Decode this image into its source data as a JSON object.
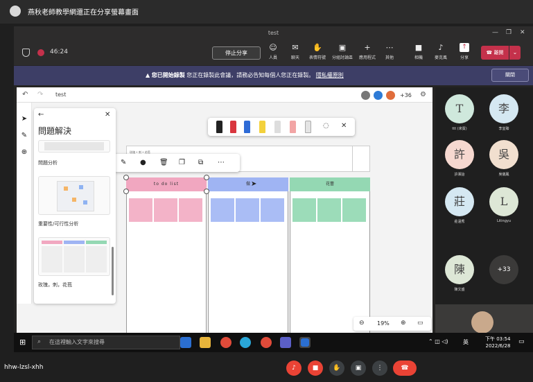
{
  "share_banner": {
    "text": "燕秋老師教學網還正在分享螢幕畫面"
  },
  "window": {
    "title": "test",
    "minimize": "—",
    "restore": "❐",
    "close": "✕"
  },
  "meeting": {
    "timer": "46:24",
    "stop_share": "停止分享",
    "toolbar": [
      {
        "label": "人員",
        "icon": "people-icon"
      },
      {
        "label": "聊天",
        "icon": "chat-icon"
      },
      {
        "label": "表情符號",
        "icon": "reactions-icon"
      },
      {
        "label": "分組討論區",
        "icon": "rooms-icon"
      },
      {
        "label": "應用程式",
        "icon": "apps-icon"
      },
      {
        "label": "其他",
        "icon": "more-icon"
      },
      {
        "label": "相機",
        "icon": "camera-off-icon"
      },
      {
        "label": "麥克風",
        "icon": "mic-off-icon"
      },
      {
        "label": "分享",
        "icon": "share-icon"
      }
    ],
    "hangup": "離開"
  },
  "recording_banner": {
    "bold": "您已開始錄製",
    "text": "您正在錄製此會議，請務必告知每個人您正在錄製。",
    "link": "隱私權原則",
    "dismiss": "關閉"
  },
  "whiteboard": {
    "title": "test",
    "collaborator_count": "+36",
    "panel": {
      "title": "問題解決",
      "templates": [
        "問題分析",
        "重要性/可行性分析",
        "玫瑰，刺，花苞"
      ]
    },
    "columns": [
      "to do list",
      "做",
      "花蕾"
    ],
    "header_text": "玫瑰 • 刺 • 花苞",
    "zoom": "19%"
  },
  "participants": [
    {
      "initial": "T",
      "name": "ttt (來賓)",
      "color": "#cfe8dc"
    },
    {
      "initial": "李",
      "name": "李宜臻",
      "color": "#d5e8f2"
    },
    {
      "initial": "許",
      "name": "許湘詒",
      "color": "#f6d8d0"
    },
    {
      "initial": "吳",
      "name": "吳儀鳳",
      "color": "#f1dfcf"
    },
    {
      "initial": "莊",
      "name": "莊涵秀",
      "color": "#d5e8f2"
    },
    {
      "initial": "L",
      "name": "Litingyu",
      "color": "#dde7d6"
    },
    {
      "initial": "陳",
      "name": "陳文盛",
      "color": "#dde7d6"
    }
  ],
  "more_participants": "+33",
  "taskbar": {
    "search_placeholder": "在這裡輸入文字來搜尋",
    "ime": "英",
    "time": "下午 03:54",
    "date": "2022/6/28"
  },
  "bottom": {
    "room_code": "hhw-lzsl-xhh"
  }
}
